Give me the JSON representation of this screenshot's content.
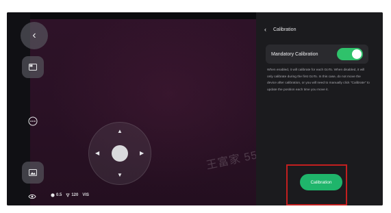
{
  "icons": {
    "back": "back-arrow-icon",
    "layout": "layout-icon",
    "gallery": "gallery-icon",
    "more": "more-icon",
    "eye": "eye-icon"
  },
  "status_bar": {
    "aperture": "0.5",
    "temperature": "120",
    "mode": "VIS"
  },
  "watermark": "王富家 5525",
  "panel": {
    "title": "Calibration",
    "setting_label": "Mandatory Calibration",
    "toggle_on": true,
    "description": "When enabled, it will calibrate for each GoTo. When disabled, it will only calibrate during the first GoTo. In this case, do not move the device after calibration, or you will need to manually click \"Calibrate\" to update the position each time you move it.",
    "calibration_button": "Calibration"
  },
  "colors": {
    "accent_green": "#1fb56b",
    "highlight_red": "#c41f1f",
    "viewport_bg": "#2a1125"
  }
}
